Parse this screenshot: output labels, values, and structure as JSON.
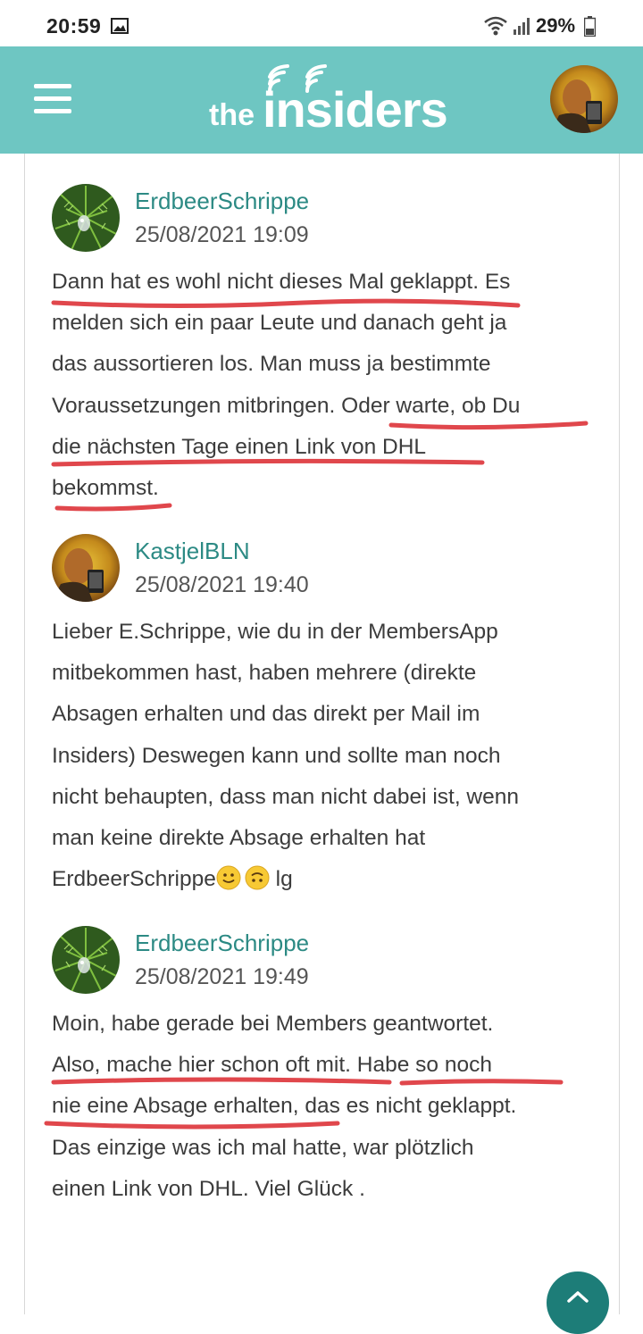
{
  "status_bar": {
    "time": "20:59",
    "battery": "29%",
    "icons": [
      "image-icon",
      "wifi-icon",
      "signal-icon",
      "battery-icon"
    ]
  },
  "header": {
    "logo_prefix": "the",
    "logo_main": "insiders",
    "accent_color": "#6ec6c2"
  },
  "posts": [
    {
      "author": "ErdbeerSchrippe",
      "date": "25/08/2021 19:09",
      "lines": [
        "Dann hat es wohl nicht dieses Mal geklappt.  Es",
        "melden sich ein paar Leute und danach geht ja",
        "das aussortieren los.  Man muss ja bestimmte",
        "Voraussetzungen mitbringen.  Oder warte, ob Du",
        "die nächsten Tage einen Link von DHL",
        "bekommst."
      ]
    },
    {
      "author": "KastjelBLN",
      "date": "25/08/2021 19:40",
      "lines": [
        "Lieber E.Schrippe, wie du in der MembersApp",
        "mitbekommen hast, haben mehrere (direkte",
        "Absagen erhalten und das direkt per Mail im",
        "Insiders) Deswegen kann und sollte man noch",
        "nicht behaupten, dass man nicht dabei ist, wenn",
        "man keine direkte Absage erhalten hat"
      ],
      "last_line_text": "ErdbeerSchrippe",
      "last_line_suffix": " lg"
    },
    {
      "author": "ErdbeerSchrippe",
      "date": "25/08/2021 19:49",
      "lines": [
        "Moin, habe gerade bei Members geantwortet.",
        "Also, mache hier schon oft mit.  Habe so noch",
        "nie eine Absage erhalten, das es nicht geklappt.",
        "Das einzige was ich mal hatte, war plötzlich",
        "einen Link von DHL.  Viel Glück  ."
      ]
    }
  ],
  "annotation_color": "#e0474c",
  "fab": {
    "icon": "chevron-up-icon"
  }
}
